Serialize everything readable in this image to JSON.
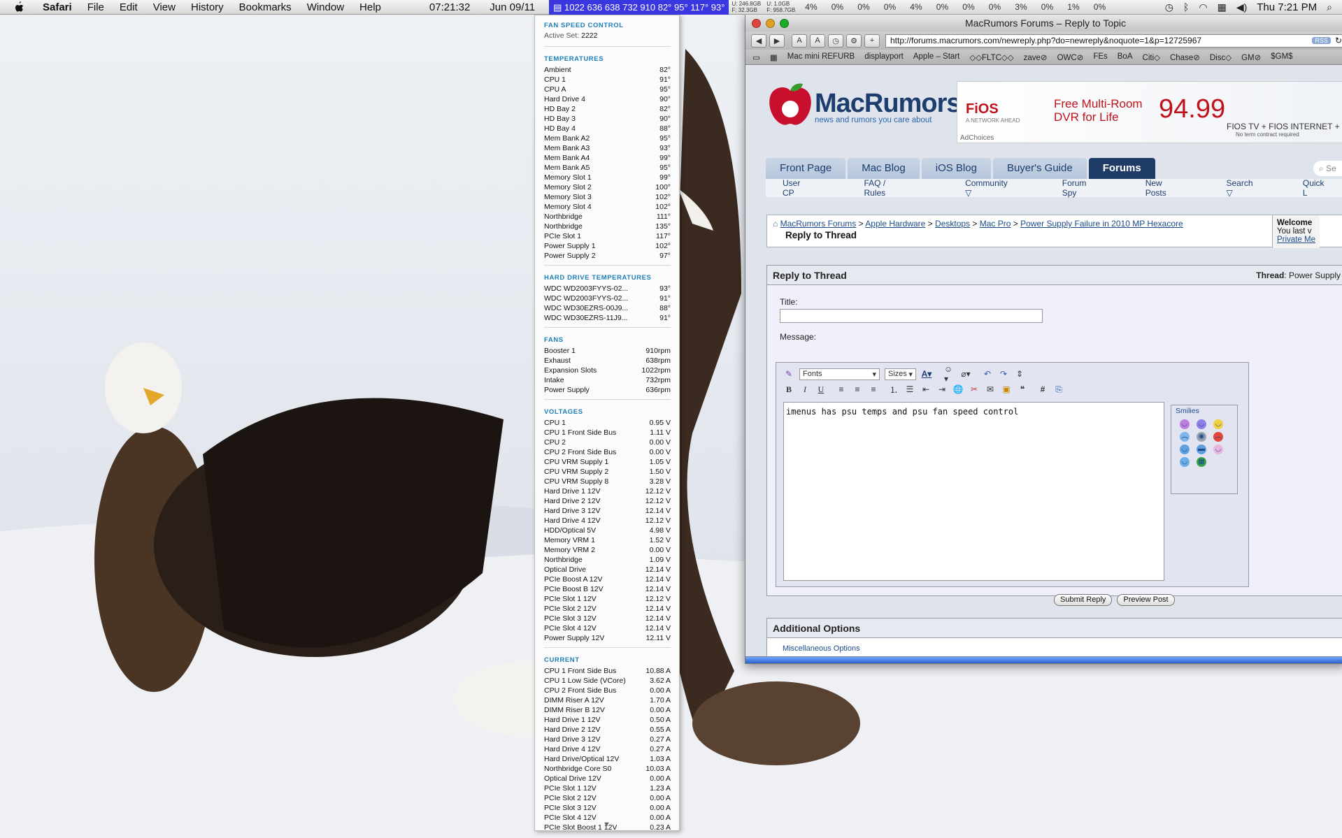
{
  "menubar": {
    "app": "Safari",
    "items": [
      "File",
      "Edit",
      "View",
      "History",
      "Bookmarks",
      "Window",
      "Help"
    ],
    "time": "07:21:32",
    "date": "Jun 09/11",
    "hardware_line": "1022 636 638 732 910 82° 95° 117° 93°",
    "disk_u": "U: 246.8GB",
    "disk_f": "F: 32.3GB",
    "disk_u2": "U: 1.0GB",
    "disk_f2": "F: 958.7GB",
    "cpu_pcts": [
      "4%",
      "0%",
      "0%",
      "0%",
      "4%",
      "0%",
      "0%",
      "0%",
      "3%",
      "0%",
      "1%",
      "0%"
    ],
    "clock": "Thu 7:21 PM"
  },
  "panel": {
    "fan_title": "FAN SPEED CONTROL",
    "active_label": "Active Set:",
    "active_value": "2222",
    "sections": [
      {
        "title": "TEMPERATURES",
        "rows": [
          [
            "Ambient",
            "82°"
          ],
          [
            "CPU 1",
            "91°"
          ],
          [
            "CPU A",
            "95°"
          ],
          [
            "Hard Drive 4",
            "90°"
          ],
          [
            "HD Bay 2",
            "82°"
          ],
          [
            "HD Bay 3",
            "90°"
          ],
          [
            "HD Bay 4",
            "88°"
          ],
          [
            "Mem Bank A2",
            "95°"
          ],
          [
            "Mem Bank A3",
            "93°"
          ],
          [
            "Mem Bank A4",
            "99°"
          ],
          [
            "Mem Bank A5",
            "95°"
          ],
          [
            "Memory Slot 1",
            "99°"
          ],
          [
            "Memory Slot 2",
            "100°"
          ],
          [
            "Memory Slot 3",
            "102°"
          ],
          [
            "Memory Slot 4",
            "102°"
          ],
          [
            "Northbridge",
            "111°"
          ],
          [
            "Northbridge",
            "135°"
          ],
          [
            "PCIe Slot 1",
            "117°"
          ],
          [
            "Power Supply 1",
            "102°"
          ],
          [
            "Power Supply 2",
            "97°"
          ]
        ]
      },
      {
        "title": "HARD DRIVE TEMPERATURES",
        "rows": [
          [
            "WDC WD2003FYYS-02...",
            "93°"
          ],
          [
            "WDC WD2003FYYS-02...",
            "91°"
          ],
          [
            "WDC WD30EZRS-00J9...",
            "88°"
          ],
          [
            "WDC WD30EZRS-11J9...",
            "91°"
          ]
        ]
      },
      {
        "title": "FANS",
        "rows": [
          [
            "Booster 1",
            "910rpm"
          ],
          [
            "Exhaust",
            "638rpm"
          ],
          [
            "Expansion Slots",
            "1022rpm"
          ],
          [
            "Intake",
            "732rpm"
          ],
          [
            "Power Supply",
            "636rpm"
          ]
        ]
      },
      {
        "title": "VOLTAGES",
        "rows": [
          [
            "CPU 1",
            "0.95 V"
          ],
          [
            "CPU 1 Front Side Bus",
            "1.11 V"
          ],
          [
            "CPU 2",
            "0.00 V"
          ],
          [
            "CPU 2 Front Side Bus",
            "0.00 V"
          ],
          [
            "CPU VRM Supply 1",
            "1.05 V"
          ],
          [
            "CPU VRM Supply 2",
            "1.50 V"
          ],
          [
            "CPU VRM Supply 8",
            "3.28 V"
          ],
          [
            "Hard Drive 1 12V",
            "12.12 V"
          ],
          [
            "Hard Drive 2 12V",
            "12.12 V"
          ],
          [
            "Hard Drive 3 12V",
            "12.14 V"
          ],
          [
            "Hard Drive 4 12V",
            "12.12 V"
          ],
          [
            "HDD/Optical 5V",
            "4.98 V"
          ],
          [
            "Memory VRM 1",
            "1.52 V"
          ],
          [
            "Memory VRM 2",
            "0.00 V"
          ],
          [
            "Northbridge",
            "1.09 V"
          ],
          [
            "Optical Drive",
            "12.14 V"
          ],
          [
            "PCIe Boost A 12V",
            "12.14 V"
          ],
          [
            "PCIe Boost B 12V",
            "12.14 V"
          ],
          [
            "PCIe Slot 1 12V",
            "12.12 V"
          ],
          [
            "PCIe Slot 2 12V",
            "12.14 V"
          ],
          [
            "PCIe Slot 3 12V",
            "12.14 V"
          ],
          [
            "PCIe Slot 4 12V",
            "12.14 V"
          ],
          [
            "Power Supply 12V",
            "12.11 V"
          ]
        ]
      },
      {
        "title": "CURRENT",
        "rows": [
          [
            "CPU 1 Front Side Bus",
            "10.88 A"
          ],
          [
            "CPU 1 Low Side (VCore)",
            "3.62 A"
          ],
          [
            "CPU 2 Front Side Bus",
            "0.00 A"
          ],
          [
            "DIMM Riser A 12V",
            "1.70 A"
          ],
          [
            "DIMM Riser B 12V",
            "0.00 A"
          ],
          [
            "Hard Drive 1 12V",
            "0.50 A"
          ],
          [
            "Hard Drive 2 12V",
            "0.55 A"
          ],
          [
            "Hard Drive 3 12V",
            "0.27 A"
          ],
          [
            "Hard Drive 4 12V",
            "0.27 A"
          ],
          [
            "Hard Drive/Optical 12V",
            "1.03 A"
          ],
          [
            "Northbridge Core S0",
            "10.03 A"
          ],
          [
            "Optical Drive 12V",
            "0.00 A"
          ],
          [
            "PCIe Slot 1 12V",
            "1.23 A"
          ],
          [
            "PCIe Slot 2 12V",
            "0.00 A"
          ],
          [
            "PCIe Slot 3 12V",
            "0.00 A"
          ],
          [
            "PCIe Slot 4 12V",
            "0.00 A"
          ],
          [
            "PCIe Slot Boost 1 12V",
            "0.23 A"
          ]
        ]
      }
    ]
  },
  "browser": {
    "title": "MacRumors Forums – Reply to Topic",
    "url": "http://forums.macrumors.com/newreply.php?do=newreply&noquote=1&p=12725967",
    "rss": "RSS",
    "bookmarks": [
      "Mac mini REFURB",
      "displayport",
      "Apple – Start",
      "◇◇FLTC◇◇",
      "zave⊘",
      "OWC⊘",
      "FEs",
      "BoA",
      "Citi◇",
      "Chase⊘",
      "Disc◇",
      "GM⊘",
      "$GM$"
    ],
    "logo_text": "MacRumors",
    "logo_tagline": "news and rumors you care about",
    "ad": {
      "brand": "FiOS",
      "brand_sub": "A NETWORK AHEAD",
      "deal": "Free Multi-Room DVR for Life",
      "price": "94.99",
      "footer": "FIOS TV + FIOS INTERNET + P",
      "footnote": "No term contract required",
      "choices": "AdChoices"
    },
    "tabs": [
      "Front Page",
      "Mac Blog",
      "iOS Blog",
      "Buyer's Guide",
      "Forums"
    ],
    "search_placeholder": "Se",
    "subnav": [
      "User CP",
      "FAQ / Rules",
      "Community ▽",
      "Forum Spy",
      "New Posts",
      "Search ▽",
      "Quick L"
    ],
    "breadcrumb": [
      "MacRumors Forums",
      "Apple Hardware",
      "Desktops",
      "Mac Pro",
      "Power Supply Failure in 2010 MP Hexacore"
    ],
    "breadcrumb_current": "Reply to Thread",
    "welcome": {
      "title": "Welcome",
      "line": "You last v",
      "link": "Private Me"
    },
    "reply_title": "Reply to Thread",
    "thread_label": "Thread",
    "thread_value": ": Power Supply",
    "title_label": "Title:",
    "message_label": "Message:",
    "fonts_label": "Fonts",
    "sizes_label": "Sizes",
    "message_text": "imenus has psu temps and psu fan speed control",
    "smilies_label": "Smilies",
    "submit": "Submit Reply",
    "preview": "Preview Post",
    "additional": "Additional Options",
    "misc": "Miscellaneous Options"
  }
}
